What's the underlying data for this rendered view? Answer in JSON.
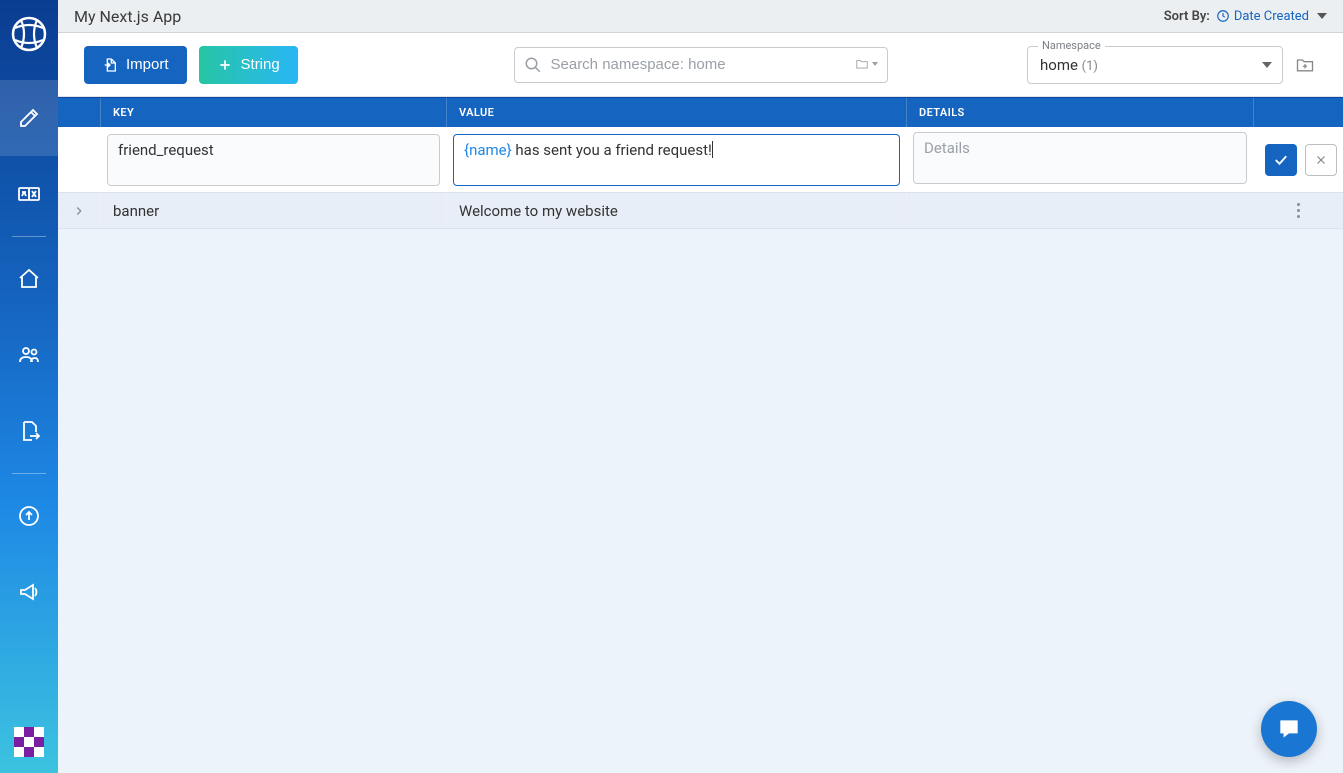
{
  "header": {
    "app_title": "My Next.js App",
    "sort_label": "Sort By:",
    "sort_value": "Date Created"
  },
  "toolbar": {
    "import_label": "Import",
    "string_label": "String",
    "search_placeholder": "Search namespace: home",
    "namespace_label": "Namespace",
    "namespace_value": "home",
    "namespace_count": "(1)"
  },
  "table": {
    "columns": {
      "key": "KEY",
      "value": "VALUE",
      "details": "DETAILS"
    },
    "edit_row": {
      "key": "friend_request",
      "value_var": "{name}",
      "value_rest": " has sent you a friend request!",
      "details_placeholder": "Details"
    },
    "rows": [
      {
        "key": "banner",
        "value": "Welcome to my website"
      }
    ]
  },
  "sidebar": {
    "items": [
      "edit",
      "translate",
      "home",
      "team",
      "export",
      "upload",
      "announce"
    ]
  }
}
